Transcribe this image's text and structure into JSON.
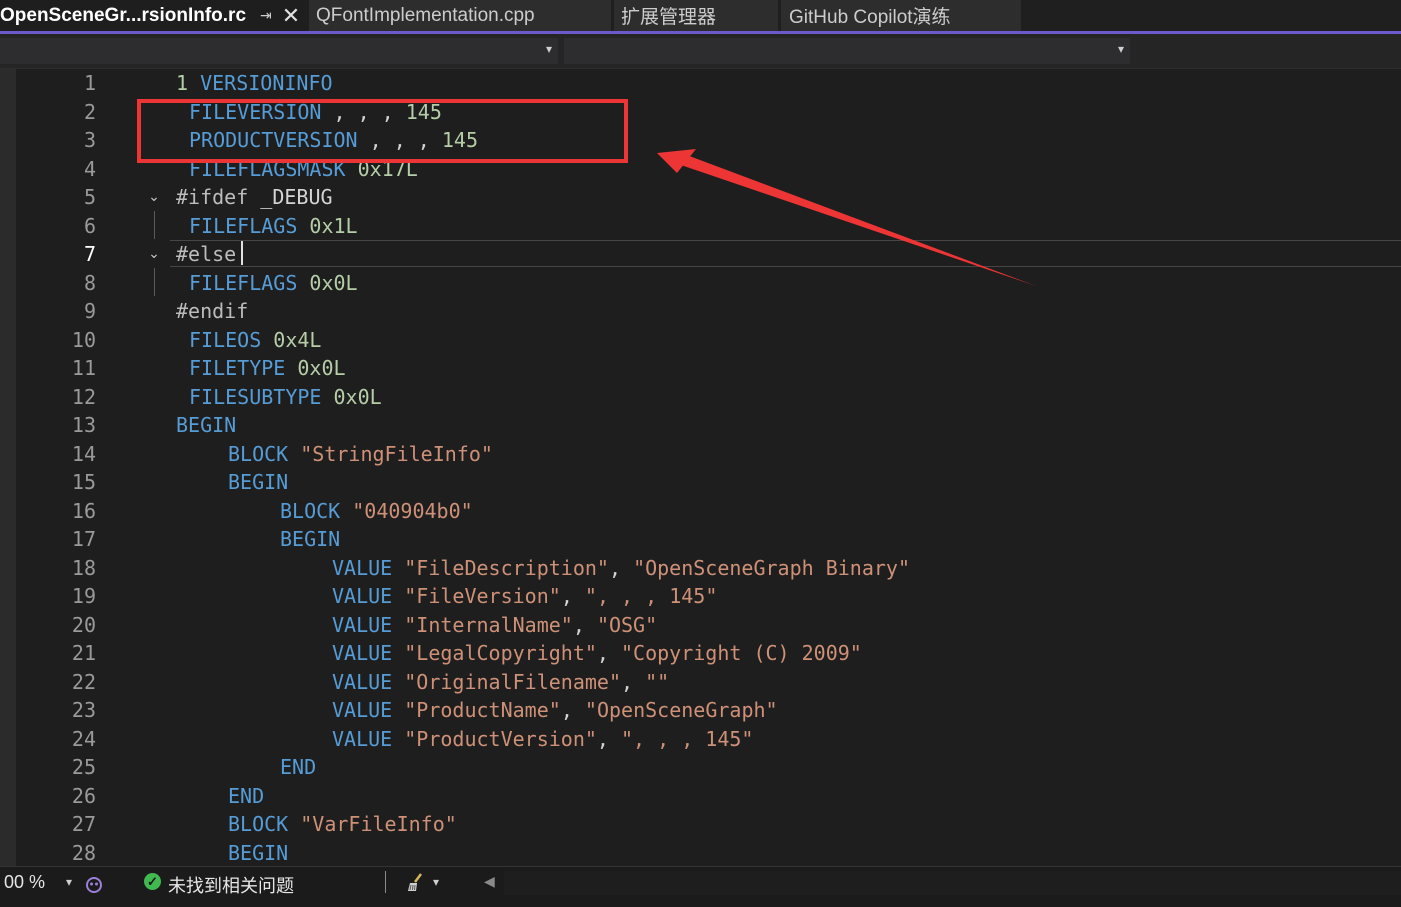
{
  "tabs": [
    {
      "label": "OpenSceneGr...rsionInfo.rc",
      "active": true,
      "pin": "⇥",
      "close": "✕"
    },
    {
      "label": "QFontImplementation.cpp",
      "active": false
    },
    {
      "label": "扩展管理器",
      "active": false
    },
    {
      "label": "GitHub Copilot演练",
      "active": false
    }
  ],
  "nav": {
    "caret1": "▾",
    "caret2": "▾"
  },
  "line_numbers": [
    "1",
    "2",
    "3",
    "4",
    "5",
    "6",
    "7",
    "8",
    "9",
    "10",
    "11",
    "12",
    "13",
    "14",
    "15",
    "16",
    "17",
    "18",
    "19",
    "20",
    "21",
    "22",
    "23",
    "24",
    "25",
    "26",
    "27",
    "28"
  ],
  "code": {
    "l1_num": "1",
    "l1_kw": "VERSIONINFO",
    "l2_kw": "FILEVERSION",
    "l2_commas": " , , , ",
    "l2_num": "145",
    "l3_kw": "PRODUCTVERSION",
    "l3_commas": " , , , ",
    "l3_num": "145",
    "l4_kw": "FILEFLAGSMASK",
    "l4_num": "0x17L",
    "l5_pp": "#ifdef",
    "l5_txt": "_DEBUG",
    "l6_kw": "FILEFLAGS",
    "l6_num": "0x1L",
    "l7_pp": "#else",
    "l8_kw": "FILEFLAGS",
    "l8_num": "0x0L",
    "l9_pp": "#endif",
    "l10_kw": "FILEOS",
    "l10_num": "0x4L",
    "l11_kw": "FILETYPE",
    "l11_num": "0x0L",
    "l12_kw": "FILESUBTYPE",
    "l12_num": "0x0L",
    "l13_kw": "BEGIN",
    "l14_kw": "BLOCK",
    "l14_str": "\"StringFileInfo\"",
    "l15_kw": "BEGIN",
    "l16_kw": "BLOCK",
    "l16_str": "\"040904b0\"",
    "l17_kw": "BEGIN",
    "l18_kw": "VALUE",
    "l18_s1": "\"FileDescription\"",
    "l18_s2": "\"OpenSceneGraph Binary\"",
    "l19_kw": "VALUE",
    "l19_s1": "\"FileVersion\"",
    "l19_s2": "\", , , 145\"",
    "l20_kw": "VALUE",
    "l20_s1": "\"InternalName\"",
    "l20_s2": "\"OSG\"",
    "l21_kw": "VALUE",
    "l21_s1": "\"LegalCopyright\"",
    "l21_s2": "\"Copyright (C) 2009\"",
    "l22_kw": "VALUE",
    "l22_s1": "\"OriginalFilename\"",
    "l22_s2": "\"\"",
    "l23_kw": "VALUE",
    "l23_s1": "\"ProductName\"",
    "l23_s2": "\"OpenSceneGraph\"",
    "l24_kw": "VALUE",
    "l24_s1": "\"ProductVersion\"",
    "l24_s2": "\", , , 145\"",
    "l25_kw": "END",
    "l26_kw": "END",
    "l27_kw": "BLOCK",
    "l27_str": "\"VarFileInfo\"",
    "l28_kw": "BEGIN",
    "comma": ",",
    "comma_space": ", "
  },
  "folds": {
    "f5": "⌄",
    "f7": "⌄"
  },
  "status": {
    "zoom": "00 %",
    "zoom_caret": "▾",
    "ok_glyph": "✓",
    "issues": "未找到相关问题",
    "broom_caret": "▾",
    "scroll_left": "◀"
  },
  "colors": {
    "keyword": "#569cd6",
    "number": "#b5cea8",
    "string": "#ce9178",
    "preprocessor": "#bdbdbd",
    "annotation": "#ee3535",
    "accent": "#6a5acd"
  }
}
